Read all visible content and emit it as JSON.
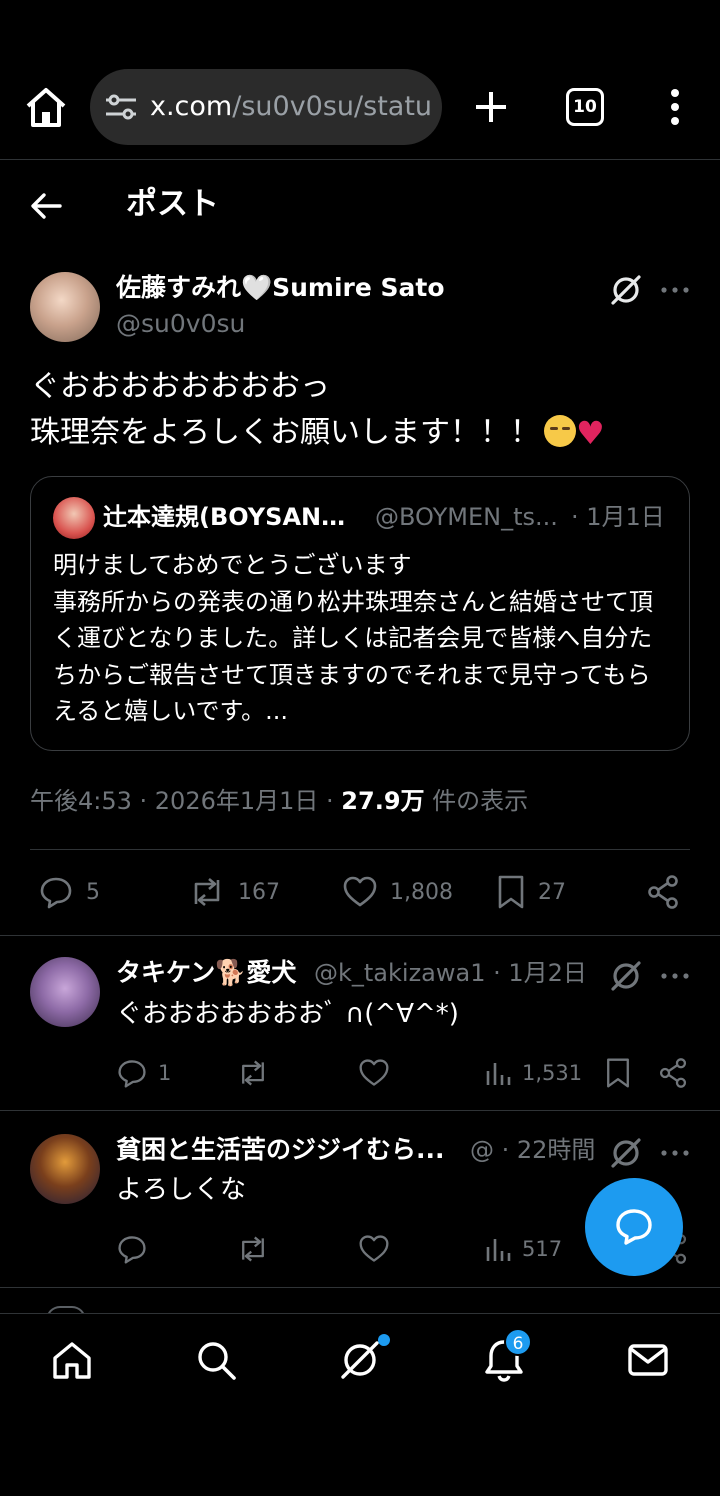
{
  "browser": {
    "url_host": "x.com",
    "url_path": "/su0v0su/statu",
    "tab_count": "10"
  },
  "header": {
    "title": "ポスト"
  },
  "main_tweet": {
    "display_name": "佐藤すみれ🤍Sumire Sato",
    "handle": "@su0v0su",
    "text_line1": "ぐおおおおおおおおっ",
    "text_line2": "珠理奈をよろしくお願いします！！！",
    "time": "午後4:53 · 2026年1月1日 · ",
    "views_count": "27.9万",
    "views_label": " 件の表示",
    "reply_count": "5",
    "retweet_count": "167",
    "like_count": "1,808",
    "bookmark_count": "27"
  },
  "quote": {
    "display_name": "辻本達規(BOYSAND...",
    "handle": "@BOYMEN_ts...",
    "date": "· 1月1日",
    "text": "明けましておめでとうございます\n事務所からの発表の通り松井珠理奈さんと結婚させて頂く運びとなりました。詳しくは記者会見で皆様へ自分たちからご報告させて頂きますのでそれまで見守ってもらえると嬉しいです。..."
  },
  "replies": [
    {
      "display_name": "タキケン🐕愛犬",
      "meta": "@k_takizawa1 · 1月2日",
      "text": "ぐおおおおおおおﾞ ∩(^∀^*)",
      "reply_count": "1",
      "views": "1,531"
    },
    {
      "display_name": "貧困と生活苦のジジイむら...",
      "meta": "@ · 22時間",
      "text": "よろしくな",
      "views": "517"
    }
  ],
  "nav": {
    "notif_badge": "6"
  },
  "colors": {
    "accent": "#1d9bf0",
    "text_secondary": "#71767b",
    "background": "#000000",
    "heart": "#e0245e"
  }
}
